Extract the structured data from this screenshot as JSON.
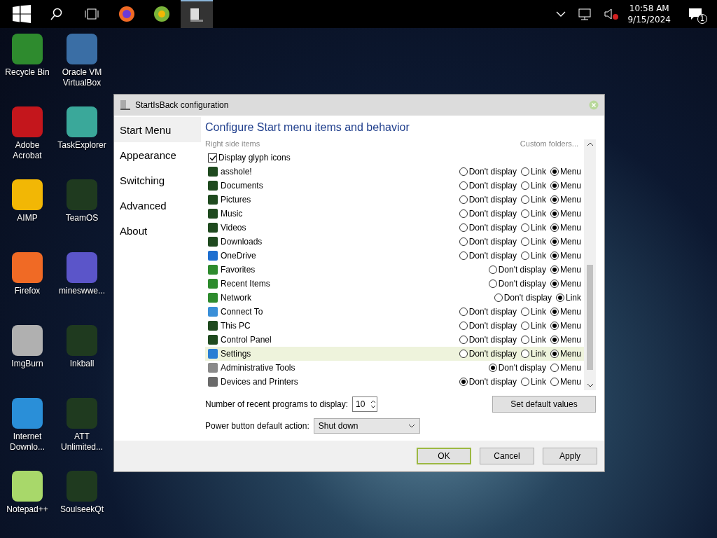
{
  "taskbar": {
    "clock_time": "10:58 AM",
    "clock_date": "9/15/2024",
    "notification_count": "1"
  },
  "desktop_icons": [
    {
      "label": "Recycle Bin",
      "color": "#2e8b2e"
    },
    {
      "label": "Oracle VM VirtualBox",
      "color": "#3a6ea5"
    },
    {
      "label": "Adobe Acrobat",
      "color": "#c4161c"
    },
    {
      "label": "TaskExplorer",
      "color": "#3aa89a"
    },
    {
      "label": "AIMP",
      "color": "#f2b705"
    },
    {
      "label": "TeamOS",
      "color": "#1f3a1f"
    },
    {
      "label": "Firefox",
      "color": "#f06a25"
    },
    {
      "label": "mineswwe...",
      "color": "#5b55c9"
    },
    {
      "label": "ImgBurn",
      "color": "#b0b0b0"
    },
    {
      "label": "Inkball",
      "color": "#1f3a1f"
    },
    {
      "label": "Internet Downlo...",
      "color": "#2a8fd8"
    },
    {
      "label": "ATT Unlimited...",
      "color": "#1f3a1f"
    },
    {
      "label": "Notepad++",
      "color": "#a8d86a"
    },
    {
      "label": "SoulseekQt",
      "color": "#1f3a1f"
    }
  ],
  "dialog": {
    "title": "StartIsBack configuration",
    "nav": [
      {
        "label": "Start Menu",
        "selected": true
      },
      {
        "label": "Appearance",
        "selected": false
      },
      {
        "label": "Switching",
        "selected": false
      },
      {
        "label": "Advanced",
        "selected": false
      },
      {
        "label": "About",
        "selected": false
      }
    ],
    "heading": "Configure Start menu items and behavior",
    "section_label": "Right side items",
    "custom_folders": "Custom folders...",
    "glyph_option": {
      "label": "Display glyph icons",
      "checked": true
    },
    "items": [
      {
        "name": "asshole!",
        "color": "#1f4a1f",
        "highlighted": false,
        "options": [
          {
            "label": "Don't display",
            "selected": false
          },
          {
            "label": "Link",
            "selected": false
          },
          {
            "label": "Menu",
            "selected": true
          }
        ]
      },
      {
        "name": "Documents",
        "color": "#1f4a1f",
        "highlighted": false,
        "options": [
          {
            "label": "Don't display",
            "selected": false
          },
          {
            "label": "Link",
            "selected": false
          },
          {
            "label": "Menu",
            "selected": true
          }
        ]
      },
      {
        "name": "Pictures",
        "color": "#1f4a1f",
        "highlighted": false,
        "options": [
          {
            "label": "Don't display",
            "selected": false
          },
          {
            "label": "Link",
            "selected": false
          },
          {
            "label": "Menu",
            "selected": true
          }
        ]
      },
      {
        "name": "Music",
        "color": "#1f4a1f",
        "highlighted": false,
        "options": [
          {
            "label": "Don't display",
            "selected": false
          },
          {
            "label": "Link",
            "selected": false
          },
          {
            "label": "Menu",
            "selected": true
          }
        ]
      },
      {
        "name": "Videos",
        "color": "#1f4a1f",
        "highlighted": false,
        "options": [
          {
            "label": "Don't display",
            "selected": false
          },
          {
            "label": "Link",
            "selected": false
          },
          {
            "label": "Menu",
            "selected": true
          }
        ]
      },
      {
        "name": "Downloads",
        "color": "#1f4a1f",
        "highlighted": false,
        "options": [
          {
            "label": "Don't display",
            "selected": false
          },
          {
            "label": "Link",
            "selected": false
          },
          {
            "label": "Menu",
            "selected": true
          }
        ]
      },
      {
        "name": "OneDrive",
        "color": "#1e6fd0",
        "highlighted": false,
        "options": [
          {
            "label": "Don't display",
            "selected": false
          },
          {
            "label": "Link",
            "selected": false
          },
          {
            "label": "Menu",
            "selected": true
          }
        ]
      },
      {
        "name": "Favorites",
        "color": "#2e8b2e",
        "highlighted": false,
        "options": [
          {
            "label": "Don't display",
            "selected": false
          },
          {
            "label": "Menu",
            "selected": true
          }
        ]
      },
      {
        "name": "Recent Items",
        "color": "#2e8b2e",
        "highlighted": false,
        "options": [
          {
            "label": "Don't display",
            "selected": false
          },
          {
            "label": "Menu",
            "selected": true
          }
        ]
      },
      {
        "name": "Network",
        "color": "#2e8b2e",
        "highlighted": false,
        "options": [
          {
            "label": "Don't display",
            "selected": false
          },
          {
            "label": "Link",
            "selected": true
          }
        ]
      },
      {
        "name": "Connect To",
        "color": "#3a8fd8",
        "highlighted": false,
        "options": [
          {
            "label": "Don't display",
            "selected": false
          },
          {
            "label": "Link",
            "selected": false
          },
          {
            "label": "Menu",
            "selected": true
          }
        ]
      },
      {
        "name": "This PC",
        "color": "#1f4a1f",
        "highlighted": false,
        "options": [
          {
            "label": "Don't display",
            "selected": false
          },
          {
            "label": "Link",
            "selected": false
          },
          {
            "label": "Menu",
            "selected": true
          }
        ]
      },
      {
        "name": "Control Panel",
        "color": "#1f4a1f",
        "highlighted": false,
        "options": [
          {
            "label": "Don't display",
            "selected": false
          },
          {
            "label": "Link",
            "selected": false
          },
          {
            "label": "Menu",
            "selected": true
          }
        ]
      },
      {
        "name": "Settings",
        "color": "#2a7fd4",
        "highlighted": true,
        "options": [
          {
            "label": "Don't display",
            "selected": false
          },
          {
            "label": "Link",
            "selected": false
          },
          {
            "label": "Menu",
            "selected": true
          }
        ]
      },
      {
        "name": "Administrative Tools",
        "color": "#8a8a8a",
        "highlighted": false,
        "options": [
          {
            "label": "Don't display",
            "selected": true
          },
          {
            "label": "Menu",
            "selected": false
          }
        ]
      },
      {
        "name": "Devices and Printers",
        "color": "#6a6a6a",
        "highlighted": false,
        "options": [
          {
            "label": "Don't display",
            "selected": true
          },
          {
            "label": "Link",
            "selected": false
          },
          {
            "label": "Menu",
            "selected": false
          }
        ]
      }
    ],
    "recent_label": "Number of recent programs to display:",
    "recent_value": "10",
    "defaults_button": "Set default values",
    "power_label": "Power button default action:",
    "power_value": "Shut down",
    "buttons": [
      {
        "label": "OK",
        "default": true
      },
      {
        "label": "Cancel",
        "default": false
      },
      {
        "label": "Apply",
        "default": false
      }
    ]
  }
}
